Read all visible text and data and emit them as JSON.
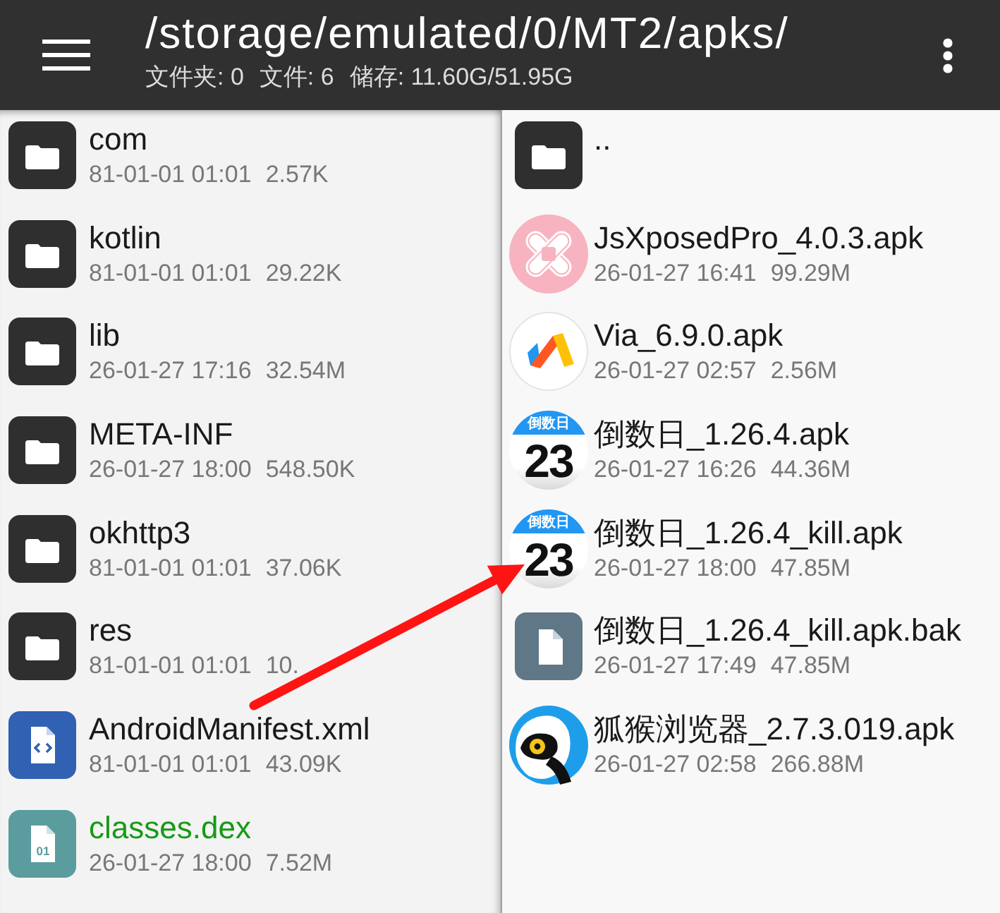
{
  "header": {
    "title": "/storage/emulated/0/MT2/apks/",
    "stats": [
      "文件夹: 0",
      "文件: 6",
      "储存: 11.60G/51.95G"
    ]
  },
  "left_pane": {
    "active": false,
    "items": [
      {
        "icon": {
          "kind": "folder"
        },
        "name": "com",
        "date": "81-01-01 01:01",
        "size": "2.57K",
        "color": "#1a1a1a"
      },
      {
        "icon": {
          "kind": "folder"
        },
        "name": "kotlin",
        "date": "81-01-01 01:01",
        "size": "29.22K",
        "color": "#1a1a1a"
      },
      {
        "icon": {
          "kind": "folder"
        },
        "name": "lib",
        "date": "26-01-27 17:16",
        "size": "32.54M",
        "color": "#1a1a1a"
      },
      {
        "icon": {
          "kind": "folder"
        },
        "name": "META-INF",
        "date": "26-01-27 18:00",
        "size": "548.50K",
        "color": "#1a1a1a"
      },
      {
        "icon": {
          "kind": "folder"
        },
        "name": "okhttp3",
        "date": "81-01-01 01:01",
        "size": "37.06K",
        "color": "#1a1a1a"
      },
      {
        "icon": {
          "kind": "folder"
        },
        "name": "res",
        "date": "81-01-01 01:01",
        "size": "10.",
        "color": "#1a1a1a"
      },
      {
        "icon": {
          "kind": "code"
        },
        "name": "AndroidManifest.xml",
        "date": "81-01-01 01:01",
        "size": "43.09K",
        "color": "#1a1a1a"
      },
      {
        "icon": {
          "kind": "binary",
          "label": "01"
        },
        "name": "classes.dex",
        "date": "26-01-27 18:00",
        "size": "7.52M",
        "color": "#169a16"
      }
    ]
  },
  "right_pane": {
    "active": true,
    "items": [
      {
        "icon": {
          "kind": "folder"
        },
        "name": ".."
      },
      {
        "icon": {
          "kind": "bandage"
        },
        "name": "JsXposedPro_4.0.3.apk",
        "date": "26-01-27 16:41",
        "size": "99.29M"
      },
      {
        "icon": {
          "kind": "chevron"
        },
        "name": "Via_6.9.0.apk",
        "date": "26-01-27 02:57",
        "size": "2.56M"
      },
      {
        "icon": {
          "kind": "calendar",
          "caption": "倒数日",
          "day": "23"
        },
        "name": "倒数日_1.26.4.apk",
        "date": "26-01-27 16:26",
        "size": "44.36M"
      },
      {
        "icon": {
          "kind": "calendar",
          "caption": "倒数日",
          "day": "23"
        },
        "name": "倒数日_1.26.4_kill.apk",
        "date": "26-01-27 18:00",
        "size": "47.85M"
      },
      {
        "icon": {
          "kind": "file"
        },
        "name": "倒数日_1.26.4_kill.apk.bak",
        "date": "26-01-27 17:49",
        "size": "47.85M"
      },
      {
        "icon": {
          "kind": "animal"
        },
        "name": "狐猴浏览器_2.7.3.019.apk",
        "date": "26-01-27 02:58",
        "size": "266.88M"
      }
    ]
  },
  "annotations": [
    {
      "kind": "arrow"
    }
  ]
}
